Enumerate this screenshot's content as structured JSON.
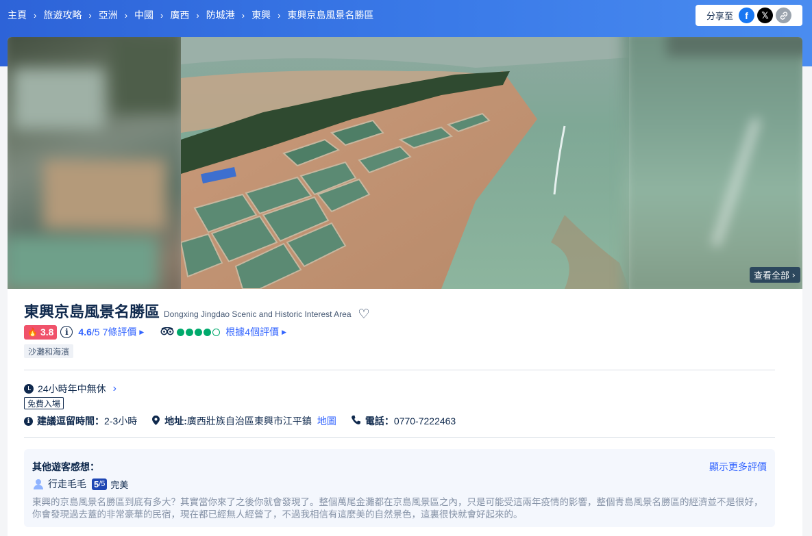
{
  "breadcrumb": [
    "主頁",
    "旅遊攻略",
    "亞洲",
    "中國",
    "廣西",
    "防城港",
    "東興",
    "東興京島風景名勝區"
  ],
  "share": {
    "label": "分享至",
    "icons": [
      "facebook-icon",
      "x-icon",
      "link-icon"
    ]
  },
  "gallery": {
    "view_all": "查看全部"
  },
  "attraction": {
    "title": "東興京島風景名勝區",
    "subtitle": "Dongxing Jingdao Scenic and Historic Interest Area",
    "hot_score": "3.8",
    "score": "4.6",
    "score_outof": "/5",
    "review_count": "7條評價",
    "tripadvisor_bubbles": 4,
    "tripadvisor_reviews": "根據4個評價",
    "tag": "沙灘和海濱"
  },
  "details": {
    "hours": "24小時年中無休",
    "free_entry": "免費入場",
    "duration_label": "建議逗留時間：",
    "duration_value": "2-3小時",
    "address_label": "地址:",
    "address_value": "廣西壯族自治區東興市江平鎮",
    "map_link": "地圖",
    "phone_label": "電話：",
    "phone_value": "0770-7222463"
  },
  "reviews": {
    "heading": "其他遊客感想：",
    "more": "顯示更多評價",
    "user": "行走毛毛",
    "rating": "5",
    "rating_outof": "/5",
    "rating_word": "完美",
    "text": "東興的京島風景名勝區到底有多大？其實當你來了之後你就會發現了。整個萬尾金灘都在京島風景區之內，只是可能受這兩年疫情的影響，整個青島風景名勝區的經濟並不是很好，你會發現過去蓋的非常豪華的民宿，現在都已經無人經營了，不過我相信有這麼美的自然景色，這裏很快就會好起來的。"
  },
  "colors": {
    "brand_blue": "#3264ff",
    "hot_red": "#f0526a",
    "tripadvisor_green": "#00aa6c",
    "header_blue": "#2d63d8"
  }
}
